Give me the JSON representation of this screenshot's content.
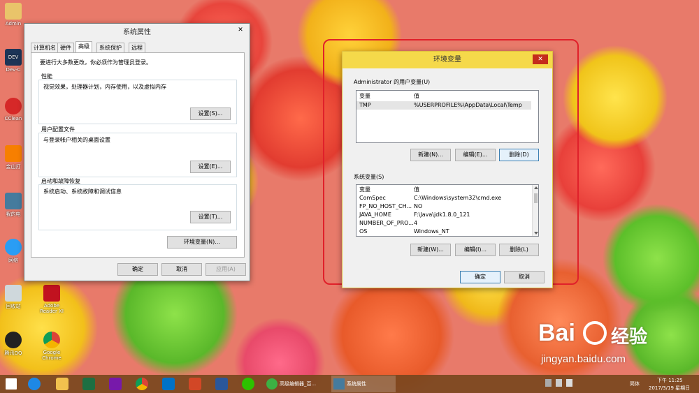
{
  "desktop": {
    "icons": [
      {
        "label": "Admin"
      },
      {
        "label": "DEV"
      },
      {
        "label": "Dev-C"
      },
      {
        "label": "CClean"
      },
      {
        "label": "金山打"
      },
      {
        "label": "我的电"
      },
      {
        "label": "网络"
      },
      {
        "label": "回收站"
      },
      {
        "label": "Adobe Reader XI"
      },
      {
        "label": "腾讯QQ"
      },
      {
        "label": "Google Chrome"
      }
    ]
  },
  "system_properties": {
    "title": "系统属性",
    "close": "✕",
    "tabs": [
      "计算机名",
      "硬件",
      "高级",
      "系统保护",
      "远程"
    ],
    "admin_note": "要进行大多数更改，你必须作为管理员登录。",
    "performance": {
      "label": "性能",
      "desc": "视觉效果，处理器计划，内存使用，以及虚拟内存",
      "button": "设置(S)..."
    },
    "user_profiles": {
      "label": "用户配置文件",
      "desc": "与登录帐户相关的桌面设置",
      "button": "设置(E)..."
    },
    "startup": {
      "label": "启动和故障恢复",
      "desc": "系统启动、系统故障和调试信息",
      "button": "设置(T)..."
    },
    "env_button": "环境变量(N)...",
    "ok": "确定",
    "cancel": "取消",
    "apply": "应用(A)"
  },
  "env_vars": {
    "title": "环境变量",
    "close": "✕",
    "user_label": "Administrator 的用户变量(U)",
    "user_headers": [
      "变量",
      "值"
    ],
    "user_rows": [
      {
        "name": "TMP",
        "value": "%USERPROFILE%\\AppData\\Local\\Temp"
      }
    ],
    "user_new": "新建(N)...",
    "user_edit": "编辑(E)...",
    "user_delete": "删除(D)",
    "system_label": "系统变量(S)",
    "system_headers": [
      "变量",
      "值"
    ],
    "system_rows": [
      {
        "name": "ComSpec",
        "value": "C:\\Windows\\system32\\cmd.exe"
      },
      {
        "name": "FP_NO_HOST_CH...",
        "value": "NO"
      },
      {
        "name": "JAVA_HOME",
        "value": "F:\\Java\\jdk1.8.0_121"
      },
      {
        "name": "NUMBER_OF_PRO...",
        "value": "4"
      },
      {
        "name": "OS",
        "value": "Windows_NT"
      }
    ],
    "sys_new": "新建(W)...",
    "sys_edit": "编辑(I)...",
    "sys_delete": "删除(L)",
    "ok": "确定",
    "cancel": "取消"
  },
  "watermark": {
    "brand": "Bai",
    "brand2": "经验",
    "url": "jingyan.baidu.com"
  },
  "taskbar": {
    "tasks": [
      {
        "label": "高级编辑器_百..."
      },
      {
        "label": "系统属性"
      }
    ],
    "ime": "简体",
    "time": "下午 11:25",
    "date": "2017/3/19 星期日"
  },
  "colors": {
    "highlight_ring": "#e0202a",
    "taskbar": "#784620",
    "dialog_bg": "#f0f0f0",
    "env_frame": "#f5d94a"
  }
}
